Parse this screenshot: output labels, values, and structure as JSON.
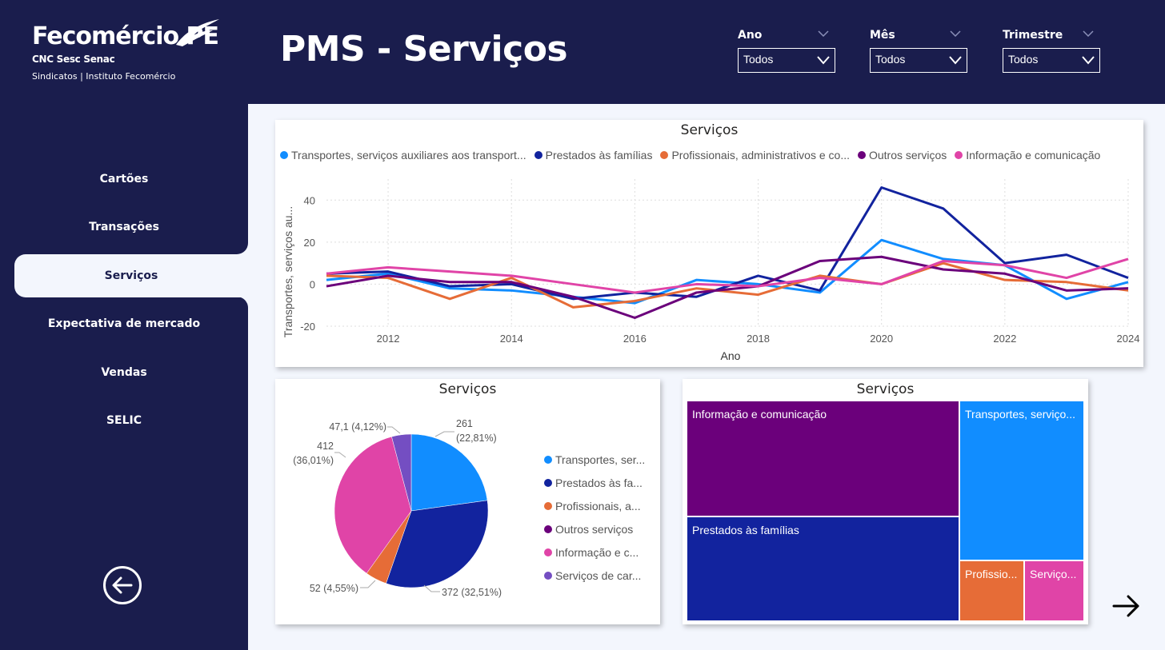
{
  "brand": {
    "name": "Fecomércio PE",
    "sub": "CNC Sesc Senac",
    "tagline": "Sindicatos | Instituto Fecomércio"
  },
  "page_title": "PMS - Serviços",
  "nav": {
    "items": [
      {
        "label": "Cartões"
      },
      {
        "label": "Transações"
      },
      {
        "label": "Serviços",
        "active": true
      },
      {
        "label": "Expectativa de mercado"
      },
      {
        "label": "Vendas"
      },
      {
        "label": "SELIC"
      }
    ]
  },
  "filters": [
    {
      "label": "Ano",
      "value": "Todos"
    },
    {
      "label": "Mês",
      "value": "Todos"
    },
    {
      "label": "Trimestre",
      "value": "Todos"
    }
  ],
  "colors": {
    "transportes": "#118dff",
    "familias": "#12239e",
    "profissionais": "#e66c37",
    "outros": "#6b007b",
    "informacao": "#e044a7",
    "carater": "#744ec2"
  },
  "line_chart": {
    "title": "Serviços",
    "legend": [
      "Transportes, serviços auxiliares aos transport...",
      "Prestados às famílias",
      "Profissionais, administrativos e co...",
      "Outros serviços",
      "Informação e comunicação"
    ],
    "xlabel": "Ano",
    "ylabel": "Transportes, serviços au...",
    "x_ticks": [
      "2012",
      "2014",
      "2016",
      "2018",
      "2020",
      "2022",
      "2024"
    ],
    "y_ticks": [
      "40",
      "20",
      "0",
      "-20"
    ]
  },
  "chart_data": [
    {
      "type": "line",
      "title": "Serviços",
      "xlabel": "Ano",
      "ylabel": "Transportes, serviços au...",
      "x": [
        2011,
        2012,
        2013,
        2014,
        2015,
        2016,
        2017,
        2018,
        2019,
        2020,
        2021,
        2022,
        2023,
        2024
      ],
      "ylim": [
        -20,
        50
      ],
      "xlim": [
        2011,
        2024
      ],
      "grid": true,
      "legend": "top",
      "series": [
        {
          "name": "Transportes, serviços auxiliares aos transport...",
          "values": [
            2,
            5,
            -2,
            -3,
            -6,
            -9,
            2,
            0,
            -4,
            21,
            12,
            9,
            -7,
            1
          ]
        },
        {
          "name": "Prestados às famílias",
          "values": [
            5,
            6,
            -1,
            0,
            -7,
            -4,
            -6,
            4,
            -3,
            46,
            36,
            10,
            14,
            3
          ]
        },
        {
          "name": "Profissionais, administrativos e co...",
          "values": [
            4,
            3,
            -7,
            3,
            -11,
            -8,
            -2,
            -5,
            4,
            0,
            10,
            2,
            1,
            -3
          ]
        },
        {
          "name": "Outros serviços",
          "values": [
            -1,
            4,
            1,
            1,
            -6,
            -16,
            -4,
            -1,
            11,
            13,
            7,
            5,
            -3,
            -2
          ]
        },
        {
          "name": "Informação e comunicação",
          "values": [
            5,
            8,
            6,
            4,
            0,
            -4,
            0,
            -1,
            3,
            0,
            11,
            9,
            3,
            12
          ]
        }
      ]
    },
    {
      "type": "pie",
      "title": "Serviços",
      "legend": "right",
      "series": [
        {
          "name": "Transportes, ser...",
          "value": 261,
          "label": "261 (22,81%)"
        },
        {
          "name": "Prestados às fa...",
          "value": 372,
          "label": "372 (32,51%)"
        },
        {
          "name": "Profissionais, a...",
          "value": 52,
          "label": "52 (4,55%)"
        },
        {
          "name": "Outros serviços",
          "value": 0
        },
        {
          "name": "Informação e c...",
          "value": 412,
          "label": "412 (36,01%)"
        },
        {
          "name": "Serviços de car...",
          "value": 47.1,
          "label": "47,1 (4,12%)"
        }
      ]
    },
    {
      "type": "treemap",
      "title": "Serviços",
      "cells": [
        {
          "name": "Informação e comunicação"
        },
        {
          "name": "Prestados às famílias"
        },
        {
          "name": "Transportes, serviço..."
        },
        {
          "name": "Profissio..."
        },
        {
          "name": "Serviço..."
        }
      ]
    }
  ],
  "pie": {
    "labels": {
      "a": "261",
      "a2": "(22,81%)",
      "b": "372 (32,51%)",
      "c": "52 (4,55%)",
      "d": "412",
      "d2": "(36,01%)",
      "e": "47,1 (4,12%)"
    }
  }
}
